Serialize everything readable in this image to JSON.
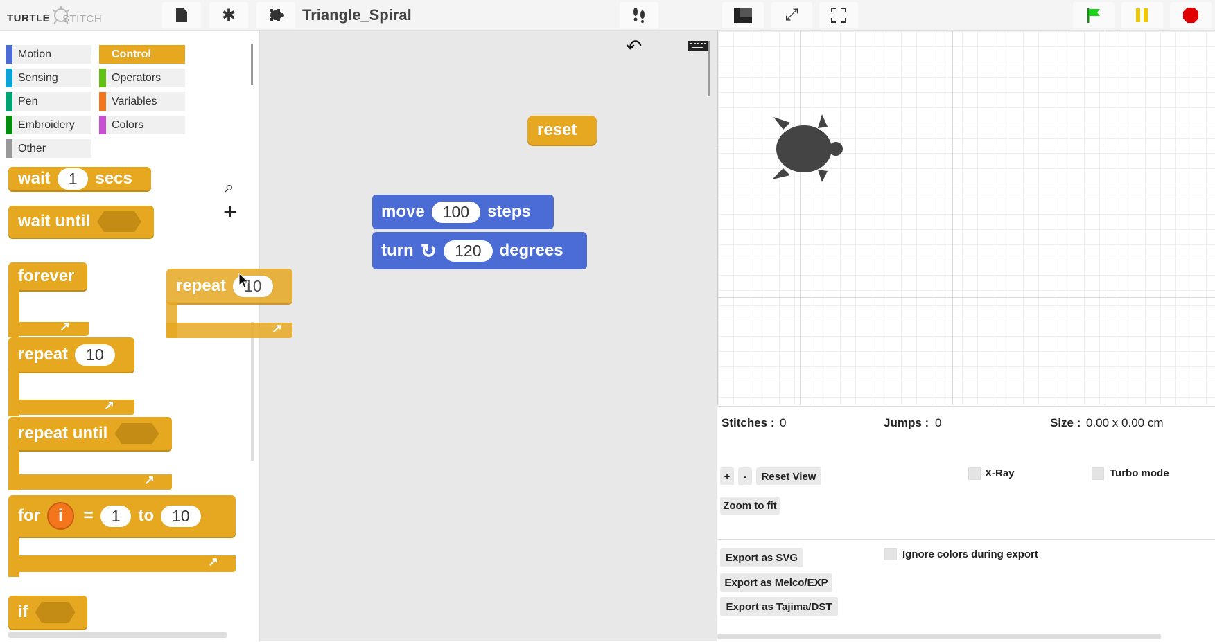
{
  "app": {
    "logo_a": "TURTLE",
    "logo_b": "STITCH",
    "project_title": "Triangle_Spiral"
  },
  "toolbar": {
    "file_icon": "file-icon",
    "settings_icon": "gear-icon",
    "sprite_icon": "turtle-icon",
    "steps_icon": "footprints-icon",
    "stage_size_icon": "stage-small-icon",
    "expand_icon": "expand-icon",
    "fullscreen_icon": "fullscreen-icon",
    "go_icon": "green-flag-icon",
    "pause_icon": "pause-icon",
    "stop_icon": "stop-icon"
  },
  "categories": [
    {
      "label": "Motion",
      "color": "#4a6cd4"
    },
    {
      "label": "Control",
      "color": "#e6a821",
      "selected": true
    },
    {
      "label": "Sensing",
      "color": "#0ca3d6"
    },
    {
      "label": "Operators",
      "color": "#62c213"
    },
    {
      "label": "Pen",
      "color": "#00a172"
    },
    {
      "label": "Variables",
      "color": "#f3761d"
    },
    {
      "label": "Embroidery",
      "color": "#038c0e"
    },
    {
      "label": "Colors",
      "color": "#c94fd2"
    },
    {
      "label": "Other",
      "color": "#999999"
    }
  ],
  "palette_blocks": {
    "wait_a": "wait",
    "wait_val": "1",
    "wait_b": "secs",
    "wait_until": "wait until",
    "forever": "forever",
    "repeat": "repeat",
    "repeat_val": "10",
    "repeat_until": "repeat until",
    "for": "for",
    "for_var": "i",
    "for_eq": "=",
    "for_from": "1",
    "for_to": "to",
    "for_end": "10",
    "if": "if"
  },
  "dragging_block": {
    "label": "repeat",
    "value": "10"
  },
  "script_blocks": {
    "reset": "reset",
    "move": "move",
    "move_val": "100",
    "move_unit": "steps",
    "turn": "turn",
    "turn_val": "120",
    "turn_unit": "degrees"
  },
  "info": {
    "stitches_label": "Stitches :",
    "stitches_val": "0",
    "jumps_label": "Jumps :",
    "jumps_val": "0",
    "size_label": "Size :",
    "size_val": "0.00 x 0.00 cm",
    "zoom_in": "+",
    "zoom_out": "-",
    "reset_view": "Reset View",
    "zoom_fit": "Zoom to fit",
    "xray": "X-Ray",
    "turbo": "Turbo mode",
    "export_svg": "Export as SVG",
    "export_exp": "Export as Melco/EXP",
    "export_dst": "Export as Tajima/DST",
    "ignore_colors": "Ignore colors during export"
  }
}
